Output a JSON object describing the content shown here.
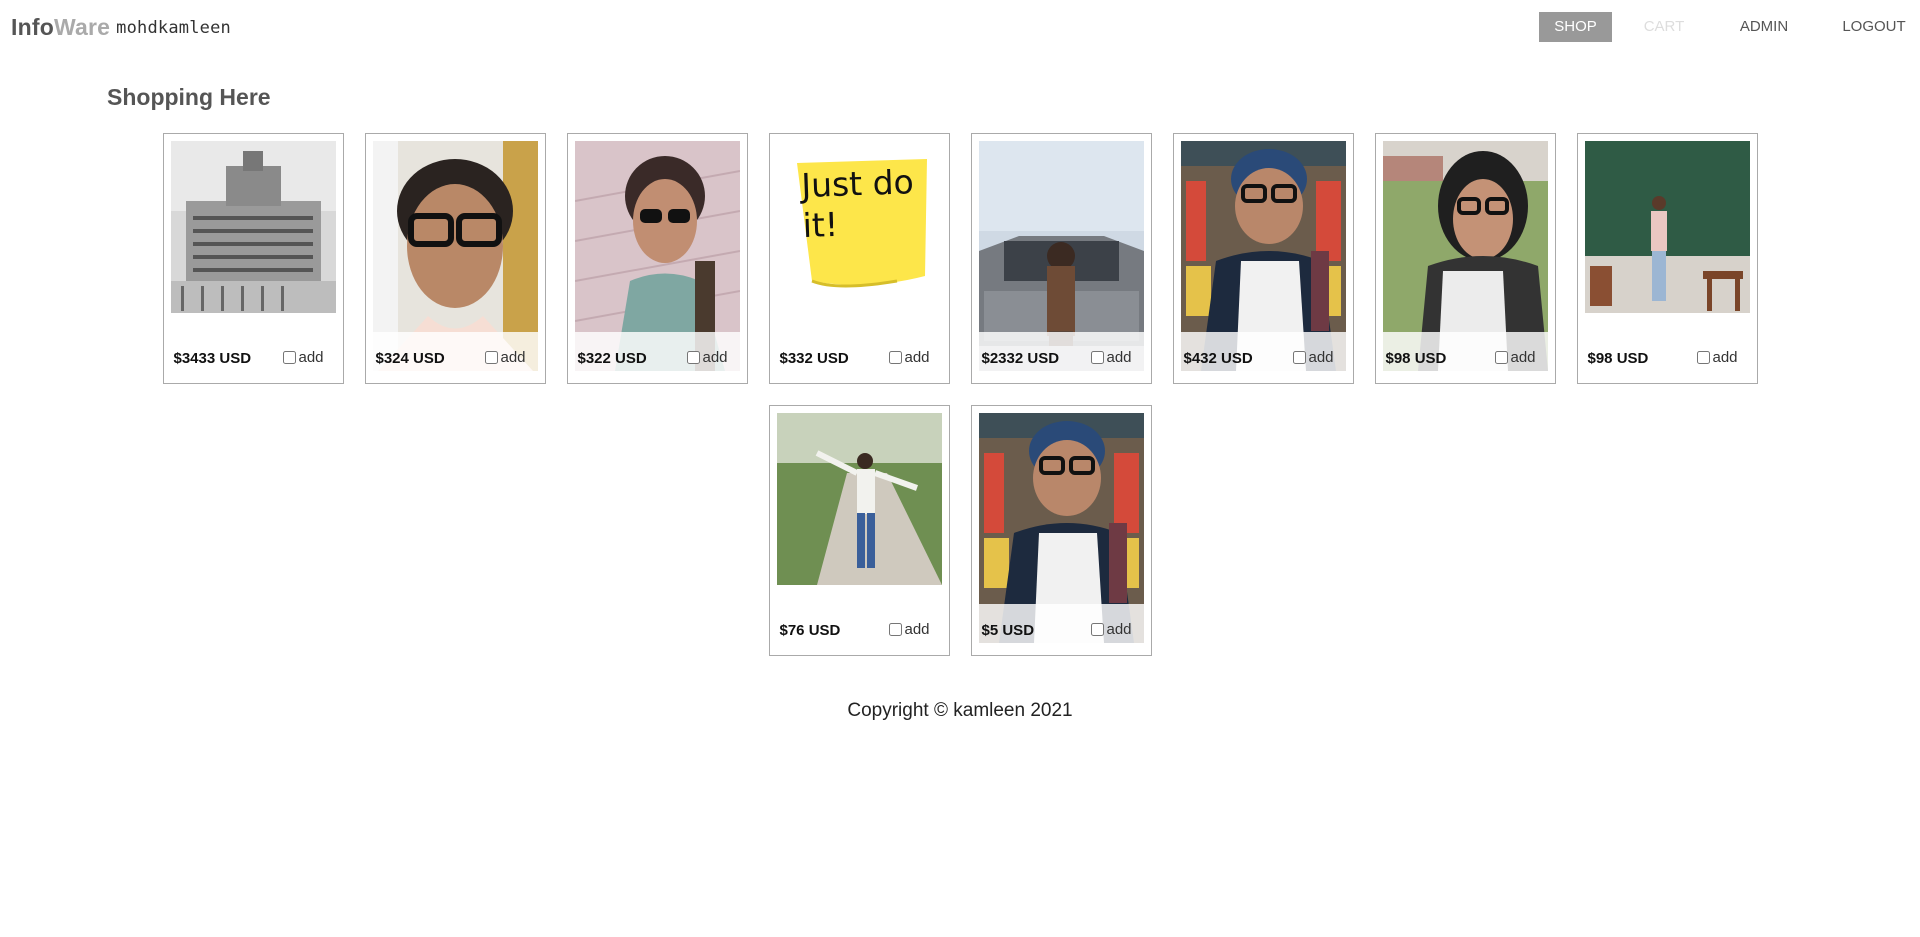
{
  "brand": {
    "part1": "Info",
    "part2": "Ware",
    "username": "mohdkamleen"
  },
  "nav": {
    "shop": "SHOP",
    "cart": "CART",
    "admin": "ADMIN",
    "logout": "LOGOUT"
  },
  "page_title": "Shopping Here",
  "products": [
    {
      "price": "$3433 USD",
      "add_label": "add",
      "image": "building-photo"
    },
    {
      "price": "$324 USD",
      "add_label": "add",
      "image": "portrait-glasses-photo"
    },
    {
      "price": "$322 USD",
      "add_label": "add",
      "image": "selfie-sunglasses-photo"
    },
    {
      "price": "$332 USD",
      "add_label": "add",
      "image": "sticky-note-photo",
      "sticky_text": "Just do it!"
    },
    {
      "price": "$2332 USD",
      "add_label": "add",
      "image": "car-photo"
    },
    {
      "price": "$432 USD",
      "add_label": "add",
      "image": "market-selfie-photo"
    },
    {
      "price": "$98 USD",
      "add_label": "add",
      "image": "hoodie-selfie-photo"
    },
    {
      "price": "$98 USD",
      "add_label": "add",
      "image": "classroom-photo"
    },
    {
      "price": "$76 USD",
      "add_label": "add",
      "image": "road-photo"
    },
    {
      "price": "$5 USD",
      "add_label": "add",
      "image": "market-selfie-photo"
    }
  ],
  "footer": "Copyright © kamleen 2021",
  "colors": {
    "nav_active_bg": "#999999",
    "nav_disabled": "#dddddd",
    "brand_light": "#aaaaaa"
  }
}
